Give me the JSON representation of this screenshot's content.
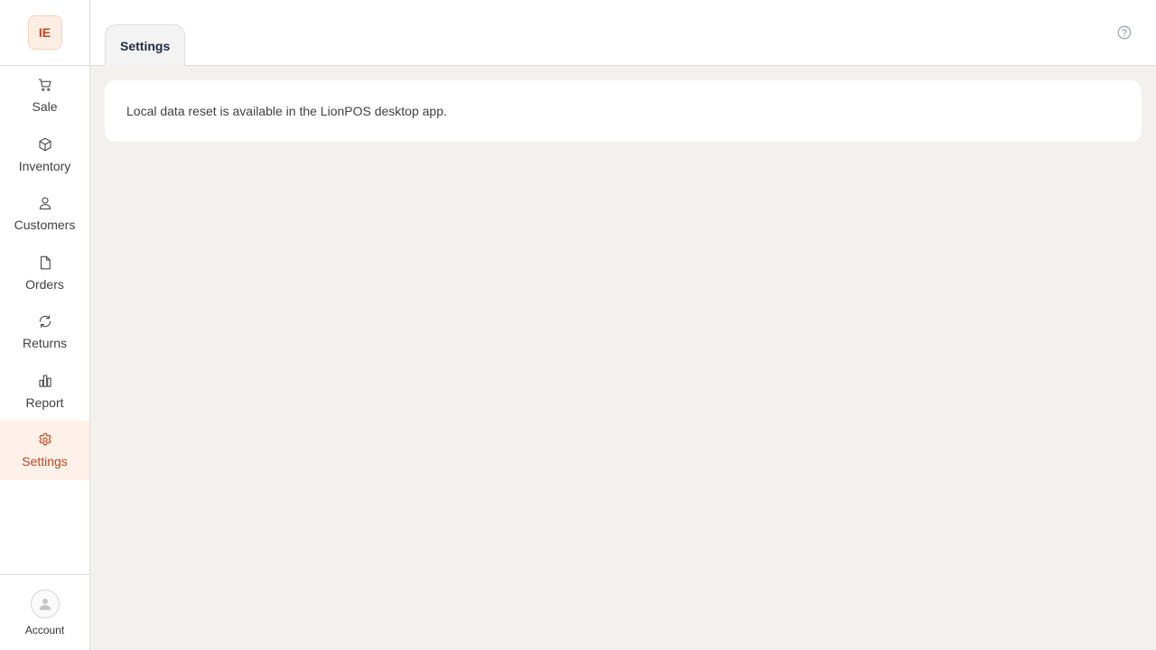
{
  "sidebar": {
    "logo_text": "IE",
    "items": [
      {
        "label": "Sale",
        "icon": "cart-icon",
        "active": false
      },
      {
        "label": "Inventory",
        "icon": "box-icon",
        "active": false
      },
      {
        "label": "Customers",
        "icon": "user-icon",
        "active": false
      },
      {
        "label": "Orders",
        "icon": "document-icon",
        "active": false
      },
      {
        "label": "Returns",
        "icon": "refresh-icon",
        "active": false
      },
      {
        "label": "Report",
        "icon": "bar-chart-icon",
        "active": false
      },
      {
        "label": "Settings",
        "icon": "gear-icon",
        "active": true
      }
    ],
    "account_label": "Account"
  },
  "header": {
    "active_tab": "Settings",
    "help_icon": "help-icon"
  },
  "main": {
    "message": "Local data reset is available in the LionPOS desktop app."
  },
  "colors": {
    "accent": "#c2461a",
    "active_bg": "#fdf1ea",
    "page_bg": "#f3f1ed"
  }
}
